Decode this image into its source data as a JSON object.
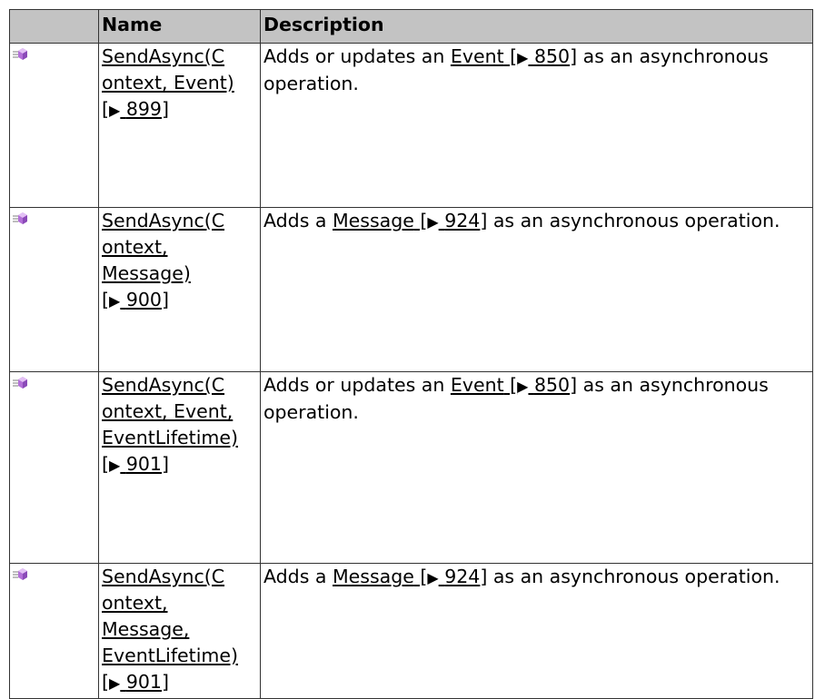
{
  "table": {
    "headers": {
      "icon": "",
      "name": "Name",
      "description": "Description"
    },
    "rows": [
      {
        "icon": "public-method-icon",
        "name_lines": [
          "SendAsync(C",
          "ontext, Event)"
        ],
        "name_ref": "899",
        "desc_pre": "Adds or updates an ",
        "desc_link": "Event",
        "desc_ref": "850",
        "desc_post": " as an asynchronous operation."
      },
      {
        "icon": "public-method-icon",
        "name_lines": [
          "SendAsync(C",
          "ontext,",
          "Message)"
        ],
        "name_ref": "900",
        "desc_pre": "Adds a ",
        "desc_link": "Message",
        "desc_ref": "924",
        "desc_post": " as an asynchronous operation."
      },
      {
        "icon": "public-method-icon",
        "name_lines": [
          "SendAsync(C",
          "ontext, Event,",
          "EventLifetime)"
        ],
        "name_ref": "901",
        "desc_pre": "Adds or updates an ",
        "desc_link": "Event",
        "desc_ref": "850",
        "desc_post": " as an asynchronous operation."
      },
      {
        "icon": "public-method-icon",
        "name_lines": [
          "SendAsync(C",
          "ontext,",
          "Message,",
          "EventLifetime)"
        ],
        "name_ref": "901",
        "desc_pre": "Adds a ",
        "desc_link": "Message",
        "desc_ref": "924",
        "desc_post": " as an asynchronous operation."
      }
    ]
  },
  "colors": {
    "header_bg": "#c3c3c3",
    "border": "#333333",
    "icon_purple": "#b36fd8"
  }
}
